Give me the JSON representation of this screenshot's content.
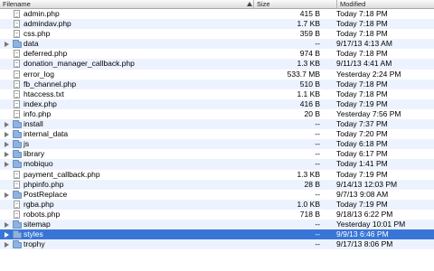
{
  "columns": {
    "filename": "Filename",
    "size": "Size",
    "modified": "Modified"
  },
  "rows": [
    {
      "type": "file",
      "name": "admin.php",
      "size": "415 B",
      "modified": "Today 7:18 PM"
    },
    {
      "type": "file",
      "name": "admindav.php",
      "size": "1.7 KB",
      "modified": "Today 7:18 PM"
    },
    {
      "type": "file",
      "name": "css.php",
      "size": "359 B",
      "modified": "Today 7:18 PM"
    },
    {
      "type": "folder",
      "name": "data",
      "size": "--",
      "modified": "9/17/13 4:13 AM"
    },
    {
      "type": "file",
      "name": "deferred.php",
      "size": "974 B",
      "modified": "Today 7:18 PM"
    },
    {
      "type": "file",
      "name": "donation_manager_callback.php",
      "size": "1.3 KB",
      "modified": "9/11/13 4:41 AM"
    },
    {
      "type": "file",
      "name": "error_log",
      "size": "533.7 MB",
      "modified": "Yesterday 2:24 PM"
    },
    {
      "type": "file",
      "name": "fb_channel.php",
      "size": "510 B",
      "modified": "Today 7:18 PM"
    },
    {
      "type": "file",
      "name": "htaccess.txt",
      "size": "1.1 KB",
      "modified": "Today 7:18 PM"
    },
    {
      "type": "file",
      "name": "index.php",
      "size": "416 B",
      "modified": "Today 7:19 PM"
    },
    {
      "type": "file",
      "name": "info.php",
      "size": "20 B",
      "modified": "Yesterday 7:56 PM"
    },
    {
      "type": "folder",
      "name": "install",
      "size": "--",
      "modified": "Today 7:37 PM"
    },
    {
      "type": "folder",
      "name": "internal_data",
      "size": "--",
      "modified": "Today 7:20 PM"
    },
    {
      "type": "folder",
      "name": "js",
      "size": "--",
      "modified": "Today 6:18 PM"
    },
    {
      "type": "folder",
      "name": "library",
      "size": "--",
      "modified": "Today 6:17 PM"
    },
    {
      "type": "folder",
      "name": "mobiquo",
      "size": "--",
      "modified": "Today 1:41 PM"
    },
    {
      "type": "file",
      "name": "payment_callback.php",
      "size": "1.3 KB",
      "modified": "Today 7:19 PM"
    },
    {
      "type": "file",
      "name": "phpinfo.php",
      "size": "28 B",
      "modified": "9/14/13 12:03 PM"
    },
    {
      "type": "folder",
      "name": "PostReplace",
      "size": "--",
      "modified": "9/7/13 9:08 AM"
    },
    {
      "type": "file",
      "name": "rgba.php",
      "size": "1.0 KB",
      "modified": "Today 7:19 PM"
    },
    {
      "type": "file",
      "name": "robots.php",
      "size": "718 B",
      "modified": "9/18/13 6:22 PM"
    },
    {
      "type": "folder",
      "name": "sitemap",
      "size": "--",
      "modified": "Yesterday 10:01 PM"
    },
    {
      "type": "folder",
      "name": "styles",
      "size": "--",
      "modified": "9/9/13 6:46 PM",
      "selected": true
    },
    {
      "type": "folder",
      "name": "trophy",
      "size": "--",
      "modified": "9/17/13 8:06 PM"
    }
  ]
}
